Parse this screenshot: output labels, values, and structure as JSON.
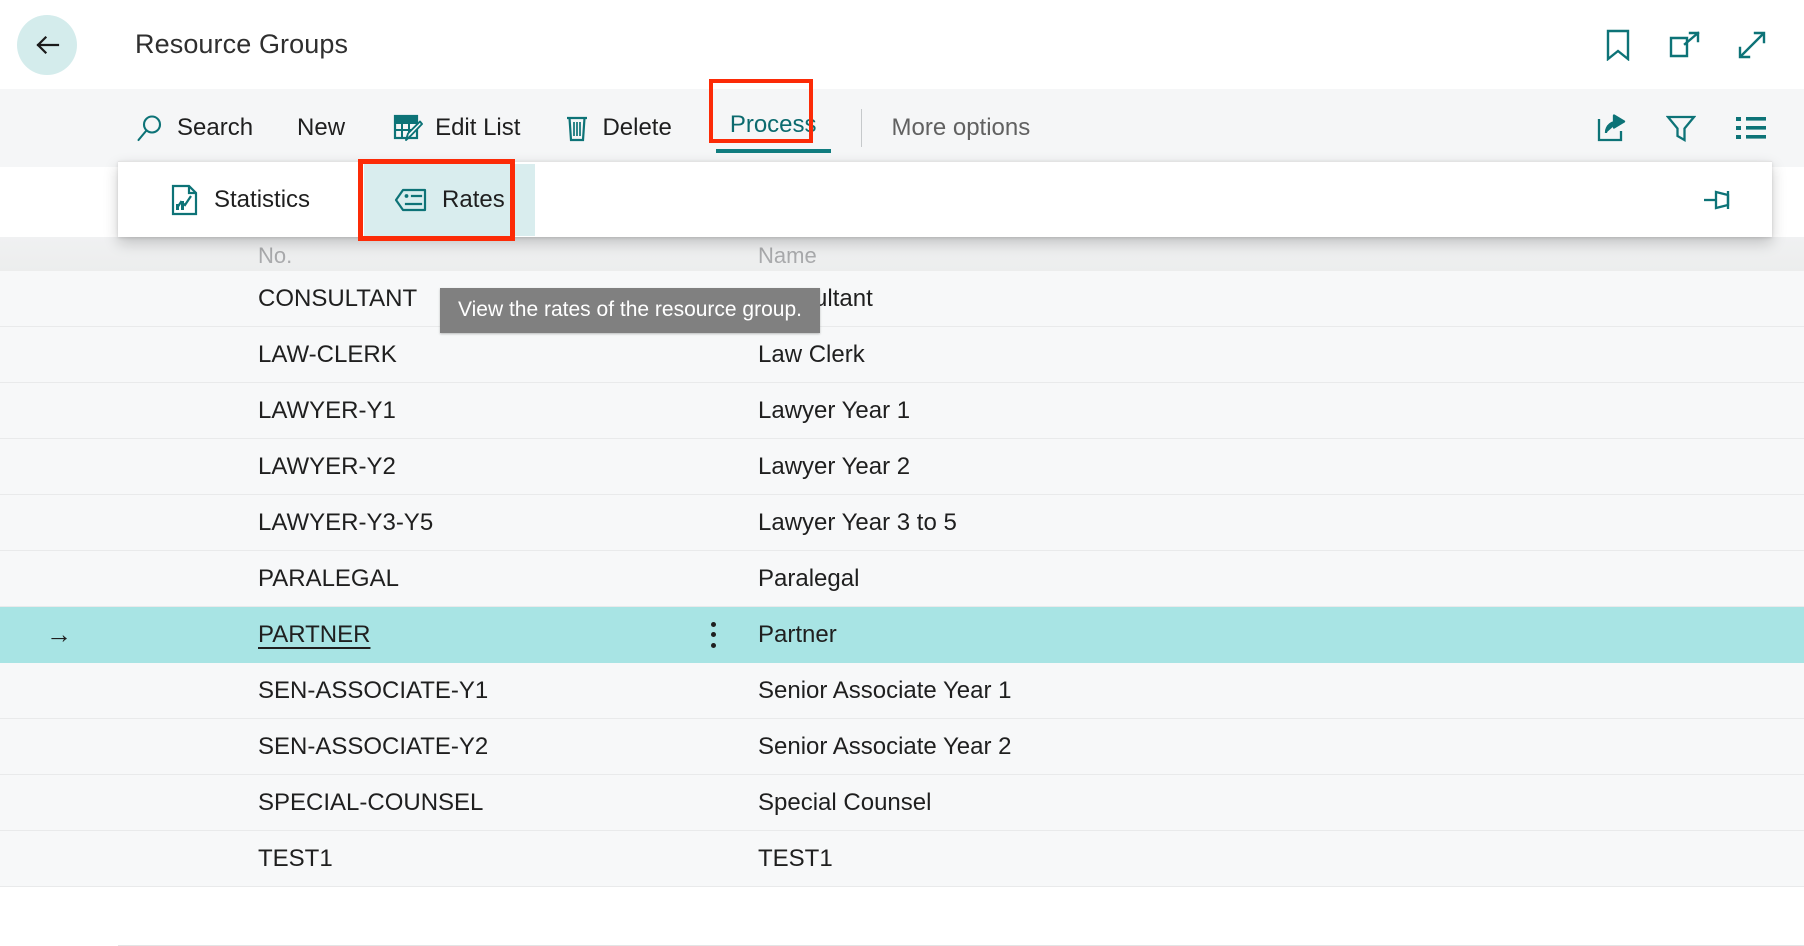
{
  "titlebar": {
    "back_label": "Back",
    "title": "Resource Groups",
    "actions": [
      {
        "name": "bookmark-icon",
        "label": "Bookmark"
      },
      {
        "name": "open-in-new-window-icon",
        "label": "Open in new window"
      },
      {
        "name": "expand-icon",
        "label": "Expand"
      }
    ]
  },
  "commandbar": {
    "search_label": "Search",
    "new_label": "New",
    "edit_list_label": "Edit List",
    "delete_label": "Delete",
    "process_label": "Process",
    "more_options_label": "More options",
    "actions": [
      {
        "name": "share-icon",
        "label": "Share"
      },
      {
        "name": "filter-icon",
        "label": "Filter"
      },
      {
        "name": "list-view-icon",
        "label": "List view"
      }
    ]
  },
  "dropdown": {
    "statistics_label": "Statistics",
    "rates_label": "Rates",
    "pin_label": "Pin"
  },
  "tooltip": {
    "text": "View the rates of the resource group."
  },
  "list": {
    "columns": {
      "no": "No.",
      "name": "Name"
    },
    "rows": [
      {
        "no": "CONSULTANT",
        "name": "Consultant",
        "selected": false,
        "indicator": ""
      },
      {
        "no": "LAW-CLERK",
        "name": "Law Clerk",
        "selected": false,
        "indicator": ""
      },
      {
        "no": "LAWYER-Y1",
        "name": "Lawyer Year 1",
        "selected": false,
        "indicator": ""
      },
      {
        "no": "LAWYER-Y2",
        "name": "Lawyer Year 2",
        "selected": false,
        "indicator": ""
      },
      {
        "no": "LAWYER-Y3-Y5",
        "name": "Lawyer Year 3 to 5",
        "selected": false,
        "indicator": ""
      },
      {
        "no": "PARALEGAL",
        "name": "Paralegal",
        "selected": false,
        "indicator": ""
      },
      {
        "no": "PARTNER",
        "name": "Partner",
        "selected": true,
        "indicator": "→"
      },
      {
        "no": "SEN-ASSOCIATE-Y1",
        "name": "Senior Associate Year 1",
        "selected": false,
        "indicator": ""
      },
      {
        "no": "SEN-ASSOCIATE-Y2",
        "name": "Senior Associate Year 2",
        "selected": false,
        "indicator": ""
      },
      {
        "no": "SPECIAL-COUNSEL",
        "name": "Special Counsel",
        "selected": false,
        "indicator": ""
      },
      {
        "no": "TEST1",
        "name": "TEST1",
        "selected": false,
        "indicator": ""
      }
    ]
  },
  "colors": {
    "accent_teal": "#107c7f",
    "back_circle": "#d4ecec",
    "selected_row": "#a8e4e4",
    "highlight_red": "#fc2b07",
    "rates_highlight": "#d9edee",
    "commandbar_bg": "#f5f6f7",
    "row_bg": "#f7f8f9",
    "tooltip_bg": "#808080"
  }
}
